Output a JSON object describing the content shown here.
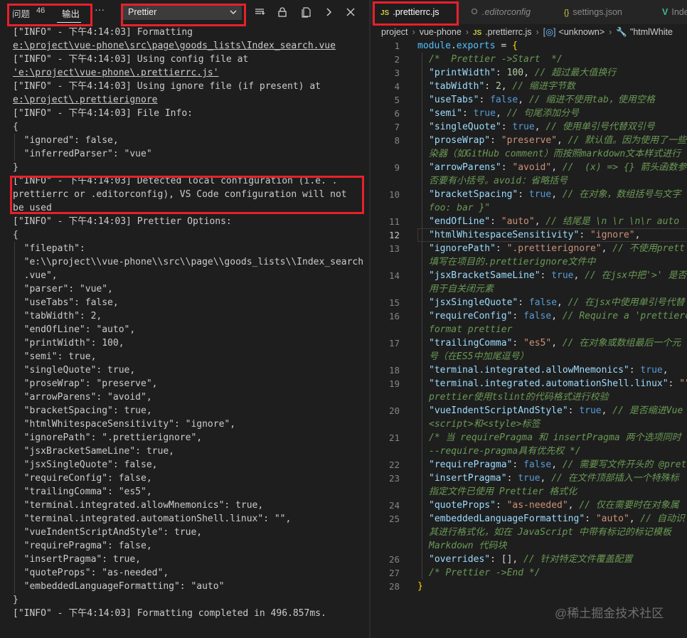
{
  "panel": {
    "tabs": {
      "problems": "问题",
      "problems_count": "46",
      "output": "输出",
      "more": "···"
    },
    "channel": "Prettier",
    "icons": [
      "list-filter-icon",
      "lock-icon",
      "copy-icon",
      "chevron-right-icon",
      "close-icon"
    ]
  },
  "output_lines": [
    "[\"INFO\" - 下午4:14:03] Formatting",
    "e:\\project\\vue-phone\\src\\page\\goods_lists\\Index_search.vue",
    "[\"INFO\" - 下午4:14:03] Using config file at",
    "'e:\\project\\vue-phone\\.prettierrc.js'",
    "[\"INFO\" - 下午4:14:03] Using ignore file (if present) at",
    "e:\\project\\.prettierignore",
    "[\"INFO\" - 下午4:14:03] File Info:",
    "{",
    "  \"ignored\": false,",
    "  \"inferredParser\": \"vue\"",
    "}",
    "[\"INFO\" - 下午4:14:03] Detected local configuration (i.e. .",
    "prettierrc or .editorconfig), VS Code configuration will not",
    "be used",
    "[\"INFO\" - 下午4:14:03] Prettier Options:",
    "{",
    "  \"filepath\":",
    "  \"e:\\\\project\\\\vue-phone\\\\src\\\\page\\\\goods_lists\\\\Index_search",
    "  .vue\",",
    "  \"parser\": \"vue\",",
    "  \"useTabs\": false,",
    "  \"tabWidth\": 2,",
    "  \"endOfLine\": \"auto\",",
    "  \"printWidth\": 100,",
    "  \"semi\": true,",
    "  \"singleQuote\": true,",
    "  \"proseWrap\": \"preserve\",",
    "  \"arrowParens\": \"avoid\",",
    "  \"bracketSpacing\": true,",
    "  \"htmlWhitespaceSensitivity\": \"ignore\",",
    "  \"ignorePath\": \".prettierignore\",",
    "  \"jsxBracketSameLine\": true,",
    "  \"jsxSingleQuote\": false,",
    "  \"requireConfig\": false,",
    "  \"trailingComma\": \"es5\",",
    "  \"terminal.integrated.allowMnemonics\": true,",
    "  \"terminal.integrated.automationShell.linux\": \"\",",
    "  \"vueIndentScriptAndStyle\": true,",
    "  \"requirePragma\": false,",
    "  \"insertPragma\": true,",
    "  \"quoteProps\": \"as-needed\",",
    "  \"embeddedLanguageFormatting\": \"auto\"",
    "}",
    "[\"INFO\" - 下午4:14:03] Formatting completed in 496.857ms."
  ],
  "editor": {
    "tabs": [
      {
        "label": ".prettierrc.js",
        "icon": "JS"
      },
      {
        "label": ".editorconfig",
        "icon": "gear"
      },
      {
        "label": "settings.json",
        "icon": "{}"
      },
      {
        "label": "Inde",
        "icon": "V"
      }
    ],
    "breadcrumb": [
      "project",
      "vue-phone",
      ".prettierrc.js",
      "<unknown>",
      "\"htmlWhite"
    ],
    "current_line": 12,
    "lines": [
      {
        "n": "1",
        "t": "module.exports = {"
      },
      {
        "n": "2",
        "t": "/*  Prettier ->Start  */"
      },
      {
        "n": "3",
        "t": "\"printWidth\": 100, // 超过最大值换行"
      },
      {
        "n": "4",
        "t": "\"tabWidth\": 2, // 缩进字节数"
      },
      {
        "n": "5",
        "t": "\"useTabs\": false, // 缩进不使用tab，使用空格"
      },
      {
        "n": "6",
        "t": "\"semi\": true, // 句尾添加分号"
      },
      {
        "n": "7",
        "t": "\"singleQuote\": true, // 使用单引号代替双引号"
      },
      {
        "n": "8",
        "t": "\"proseWrap\": \"preserve\", // 默认值。因为使用了一些"
      },
      {
        "n": "",
        "t": "染器（如GitHub comment）而按照markdown文本样式进行"
      },
      {
        "n": "9",
        "t": "\"arrowParens\": \"avoid\", //  (x) => {} 箭头函数参"
      },
      {
        "n": "",
        "t": "否要有小括号。avoid：省略括号"
      },
      {
        "n": "10",
        "t": "\"bracketSpacing\": true, // 在对象，数组括号与文字"
      },
      {
        "n": "",
        "t": "foo: bar }\""
      },
      {
        "n": "11",
        "t": "\"endOfLine\": \"auto\", // 结尾是 \\n \\r \\n\\r auto"
      },
      {
        "n": "12",
        "t": "\"htmlWhitespaceSensitivity\": \"ignore\","
      },
      {
        "n": "13",
        "t": "\"ignorePath\": \".prettierignore\", // 不使用prett"
      },
      {
        "n": "",
        "t": "填写在项目的.prettierignore文件中"
      },
      {
        "n": "14",
        "t": "\"jsxBracketSameLine\": true, // 在jsx中把'>' 是否"
      },
      {
        "n": "",
        "t": "用于自关闭元素"
      },
      {
        "n": "15",
        "t": "\"jsxSingleQuote\": false, // 在jsx中使用单引号代替"
      },
      {
        "n": "16",
        "t": "\"requireConfig\": false, // Require a 'prettierc"
      },
      {
        "n": "",
        "t": "format prettier"
      },
      {
        "n": "17",
        "t": "\"trailingComma\": \"es5\", // 在对象或数组最后一个元"
      },
      {
        "n": "",
        "t": "号（在ES5中加尾逗号）"
      },
      {
        "n": "18",
        "t": "\"terminal.integrated.allowMnemonics\": true,"
      },
      {
        "n": "19",
        "t": "\"terminal.integrated.automationShell.linux\": \"\""
      },
      {
        "n": "",
        "t": "prettier使用tslint的代码格式进行校验"
      },
      {
        "n": "20",
        "t": "\"vueIndentScriptAndStyle\": true, // 是否缩进Vue"
      },
      {
        "n": "",
        "t": "<script>和<style>标签"
      },
      {
        "n": "21",
        "t": "/* 当 requirePragma 和 insertPragma 两个选项同时"
      },
      {
        "n": "",
        "t": "--require-pragma具有优先权 */"
      },
      {
        "n": "22",
        "t": "\"requirePragma\": false, // 需要写文件开头的 @pret"
      },
      {
        "n": "23",
        "t": "\"insertPragma\": true, // 在文件顶部插入一个特殊标"
      },
      {
        "n": "",
        "t": "指定文件已使用 Prettier 格式化"
      },
      {
        "n": "24",
        "t": "\"quoteProps\": \"as-needed\", // 仅在需要时在对象属"
      },
      {
        "n": "25",
        "t": "\"embeddedLanguageFormatting\": \"auto\", // 自动识"
      },
      {
        "n": "",
        "t": "其进行格式化，如在 JavaScript 中带有标记的标记模板"
      },
      {
        "n": "",
        "t": "Markdown 代码块"
      },
      {
        "n": "26",
        "t": "\"overrides\": [], // 针对特定文件覆盖配置"
      },
      {
        "n": "27",
        "t": "/* Prettier ->End */"
      },
      {
        "n": "28",
        "t": "}"
      }
    ]
  },
  "watermark": "@稀土掘金技术社区"
}
